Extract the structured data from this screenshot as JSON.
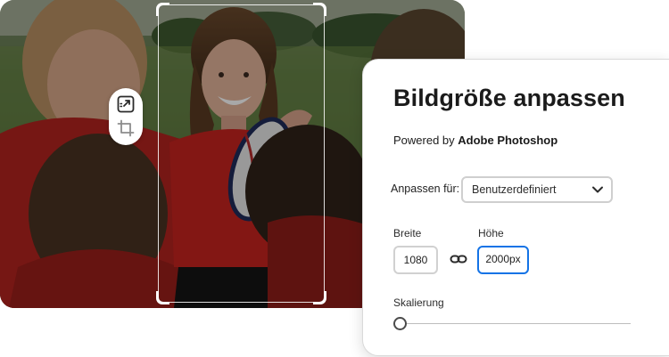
{
  "panel": {
    "title": "Bildgröße anpassen",
    "powered_prefix": "Powered by ",
    "powered_brand": "Adobe Photoshop",
    "fit_label": "Anpassen für:",
    "fit_select": {
      "selected": "Benutzerdefiniert"
    },
    "width_label": "Breite",
    "width_value": "1080",
    "height_label": "Höhe",
    "height_value": "2000px",
    "scale_label": "Skalierung",
    "scale_value": 0
  },
  "toolbar": {
    "tools": [
      "resize-icon",
      "crop-icon"
    ]
  },
  "colors": {
    "accent": "#1473e6",
    "jersey": "#c7231f",
    "field_border": "#d1d1d1",
    "title_text": "#1b1b1b"
  }
}
